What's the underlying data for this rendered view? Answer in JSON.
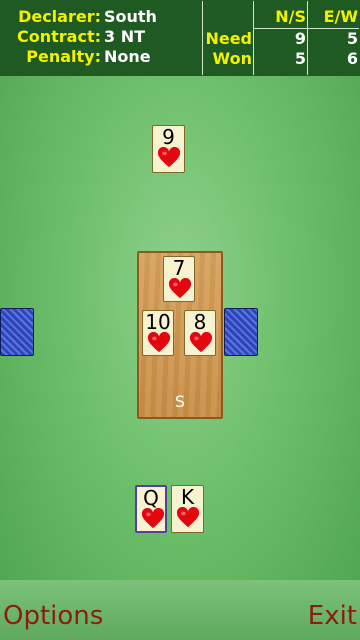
{
  "header": {
    "declarer_label": "Declarer:",
    "declarer_value": "South",
    "contract_label": "Contract:",
    "contract_value": "3 NT",
    "penalty_label": "Penalty:",
    "penalty_value": "None",
    "ns_label": "N/S",
    "ew_label": "E/W",
    "need_label": "Need",
    "won_label": "Won",
    "need_ns": "9",
    "need_ew": "5",
    "won_ns": "5",
    "won_ew": "6"
  },
  "colors": {
    "felt": "#6cbf6a",
    "header_bg": "#1e5a22",
    "label_yellow": "#f2f200",
    "heart_red": "#e3070f",
    "softkey_text": "#8c1e0c"
  },
  "table": {
    "seat_label": "S",
    "north_card": {
      "rank": "9",
      "suit": "heart"
    },
    "trick": [
      {
        "position": "north",
        "rank": "7",
        "suit": "heart"
      },
      {
        "position": "west",
        "rank": "10",
        "suit": "heart"
      },
      {
        "position": "east",
        "rank": "8",
        "suit": "heart"
      }
    ],
    "south_hand": [
      {
        "rank": "Q",
        "suit": "heart",
        "selected": true
      },
      {
        "rank": "K",
        "suit": "heart",
        "selected": false
      }
    ],
    "west_back": "card-back",
    "east_back": "card-back"
  },
  "softkeys": {
    "left": "Options",
    "right": "Exit"
  }
}
